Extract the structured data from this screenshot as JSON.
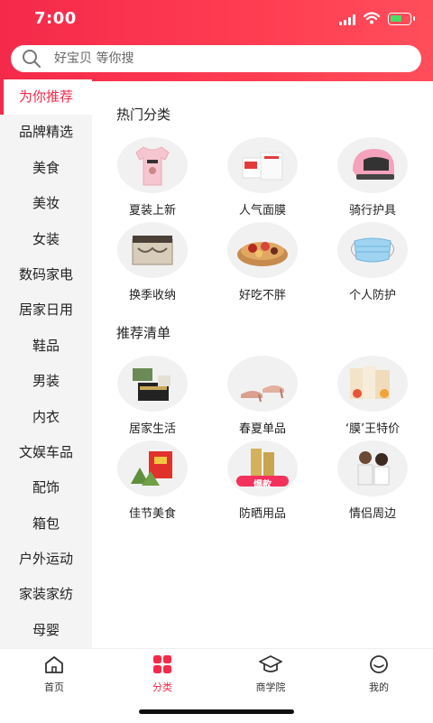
{
  "status": {
    "time": "7:00"
  },
  "search": {
    "placeholder": "好宝贝 等你搜"
  },
  "sidebar": {
    "items": [
      {
        "label": "为你推荐",
        "active": true
      },
      {
        "label": "品牌精选"
      },
      {
        "label": "美食"
      },
      {
        "label": "美妆"
      },
      {
        "label": "女装"
      },
      {
        "label": "数码家电"
      },
      {
        "label": "居家日用"
      },
      {
        "label": "鞋品"
      },
      {
        "label": "男装"
      },
      {
        "label": "内衣"
      },
      {
        "label": "文娱车品"
      },
      {
        "label": "配饰"
      },
      {
        "label": "箱包"
      },
      {
        "label": "户外运动"
      },
      {
        "label": "家装家纺"
      },
      {
        "label": "母婴"
      }
    ]
  },
  "sections": {
    "hot": {
      "title": "热门分类",
      "items": [
        {
          "label": "夏装上新",
          "icon": "tshirt-icon"
        },
        {
          "label": "人气面膜",
          "icon": "face-mask-icon"
        },
        {
          "label": "骑行护具",
          "icon": "helmet-icon"
        },
        {
          "label": "换季收纳",
          "icon": "storage-box-icon"
        },
        {
          "label": "好吃不胖",
          "icon": "snack-bowl-icon"
        },
        {
          "label": "个人防护",
          "icon": "medical-mask-icon"
        }
      ]
    },
    "recommend": {
      "title": "推荐清单",
      "items": [
        {
          "label": "居家生活",
          "icon": "home-goods-icon"
        },
        {
          "label": "春夏单品",
          "icon": "sandal-icon"
        },
        {
          "label": "‘膜’王特价",
          "icon": "mask-packs-icon"
        },
        {
          "label": "佳节美食",
          "icon": "zongzi-icon"
        },
        {
          "label": "防晒用品",
          "icon": "sunscreen-icon",
          "badge": "爆款"
        },
        {
          "label": "情侣周边",
          "icon": "couple-icon"
        }
      ]
    }
  },
  "tabbar": {
    "items": [
      {
        "label": "首页",
        "icon": "home-icon"
      },
      {
        "label": "分类",
        "icon": "category-icon",
        "active": true
      },
      {
        "label": "商学院",
        "icon": "graduation-cap-icon"
      },
      {
        "label": "我的",
        "icon": "profile-icon"
      }
    ]
  },
  "colors": {
    "accent": "#f5294a",
    "sidebar_bg": "#f4f4f4"
  }
}
